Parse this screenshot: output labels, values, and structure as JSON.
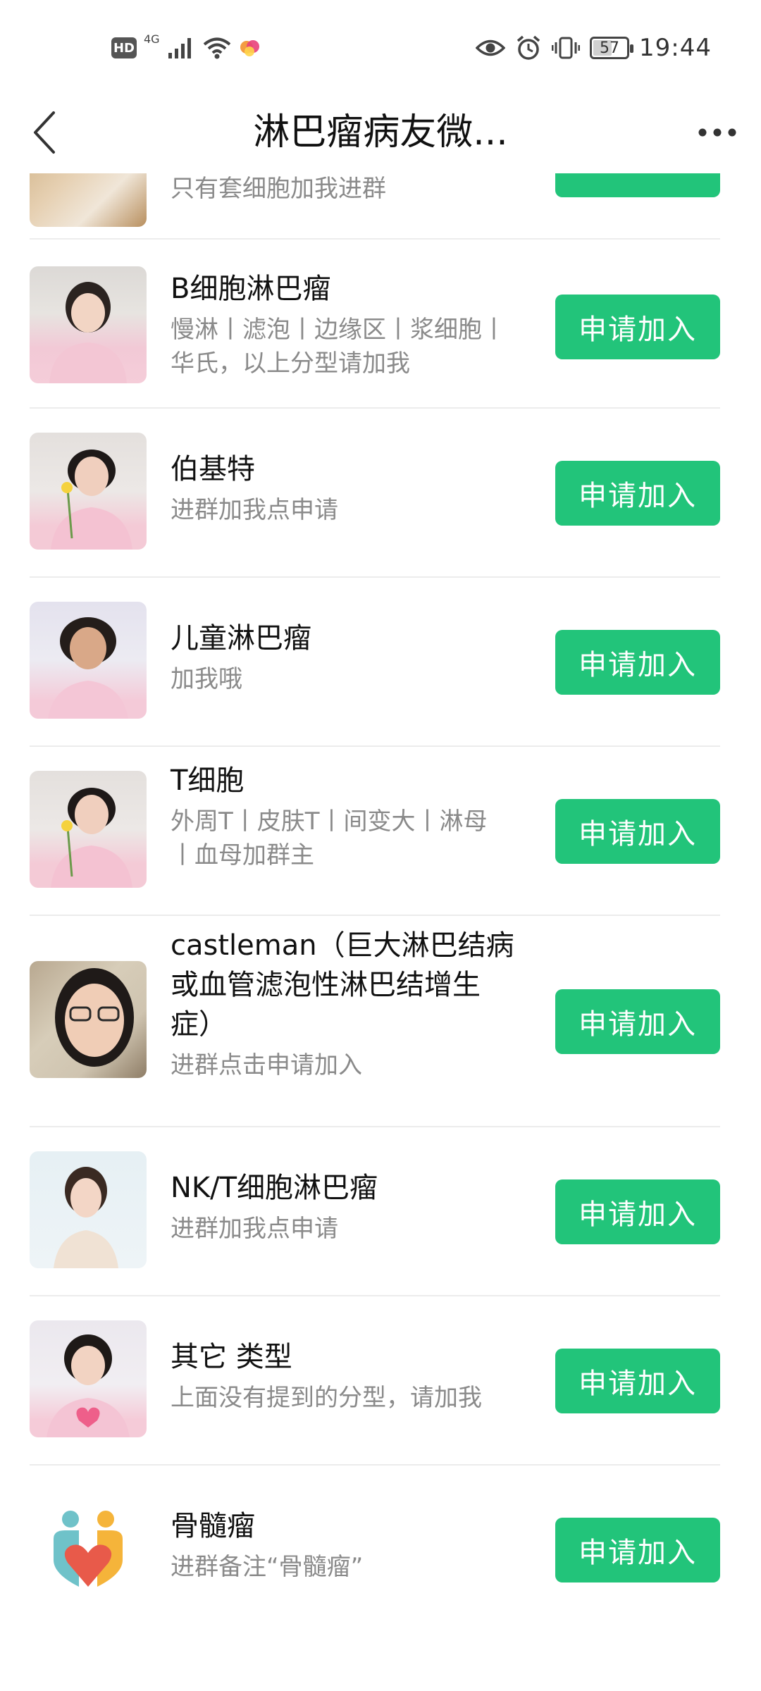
{
  "status_bar": {
    "hd": "HD",
    "network": "4G",
    "battery": "57",
    "battery_fraction": 0.57,
    "time": "19:44",
    "icons": [
      "hd-icon",
      "signal-icon",
      "wifi-icon",
      "notification-icon",
      "eye-icon",
      "alarm-icon",
      "vibrate-icon",
      "battery-icon"
    ]
  },
  "header": {
    "title": "淋巴瘤病友微..."
  },
  "partial_item": {
    "desc": "只有套细胞加我进群"
  },
  "groups": [
    {
      "title": "B细胞淋巴瘤",
      "desc_lines": [
        "慢淋丨滤泡丨边缘区丨浆细胞丨",
        "华氏，以上分型请加我"
      ],
      "button": "申请加入"
    },
    {
      "title": "伯基特",
      "desc_lines": [
        "进群加我点申请"
      ],
      "button": "申请加入"
    },
    {
      "title": "儿童淋巴瘤",
      "desc_lines": [
        "加我哦"
      ],
      "button": "申请加入"
    },
    {
      "title": "T细胞",
      "desc_lines": [
        "外周T丨皮肤T丨间变大丨淋母",
        "丨血母加群主"
      ],
      "button": "申请加入"
    },
    {
      "title_lines": [
        "castleman（巨大淋巴结病",
        "或血管滤泡性淋巴结增生",
        "症）"
      ],
      "desc_lines": [
        "进群点击申请加入"
      ],
      "button": "申请加入"
    },
    {
      "title": "NK/T细胞淋巴瘤",
      "desc_lines": [
        "进群加我点申请"
      ],
      "button": "申请加入"
    },
    {
      "title": "其它 类型",
      "desc_lines": [
        "上面没有提到的分型，请加我"
      ],
      "button": "申请加入"
    },
    {
      "title": "骨髓瘤",
      "desc_lines": [
        "进群备注“骨髓瘤”"
      ],
      "button": "申请加入"
    }
  ],
  "colors": {
    "accent": "#22c47a",
    "desc_text": "#8a8a8a",
    "divider": "#ececec"
  }
}
